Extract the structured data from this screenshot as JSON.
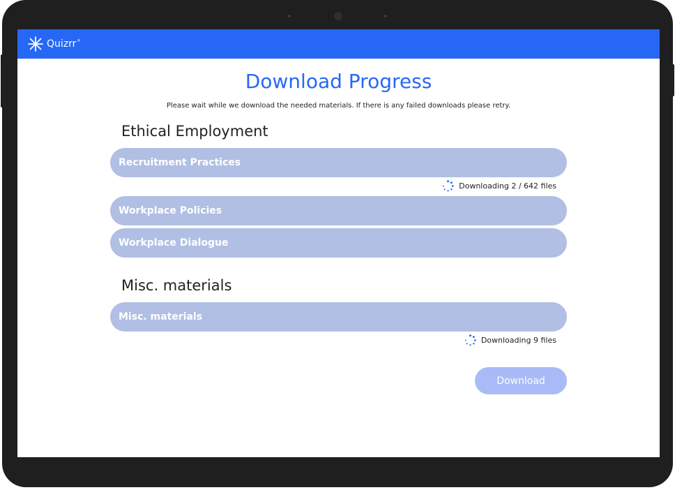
{
  "app": {
    "name": "Quizrr",
    "registered_mark": "®"
  },
  "colors": {
    "brand": "#2767f6",
    "item_bar": "#b0bfe3",
    "button_disabled": "#a8bbf7",
    "device_bezel": "#1f1f1f"
  },
  "page": {
    "title": "Download Progress",
    "subtitle": "Please wait while we download the needed materials. If there is any failed downloads please retry."
  },
  "sections": [
    {
      "heading": "Ethical Employment",
      "items": [
        {
          "label": "Recruitment Practices",
          "status": "Downloading 2 / 642 files",
          "status_icon": "loading-spinner-icon"
        },
        {
          "label": "Workplace Policies"
        },
        {
          "label": "Workplace Dialogue"
        }
      ]
    },
    {
      "heading": "Misc. materials",
      "items": [
        {
          "label": "Misc. materials",
          "status": "Downloading 9 files",
          "status_icon": "loading-spinner-icon"
        }
      ]
    }
  ],
  "actions": {
    "download_label": "Download",
    "download_state": "disabled"
  }
}
